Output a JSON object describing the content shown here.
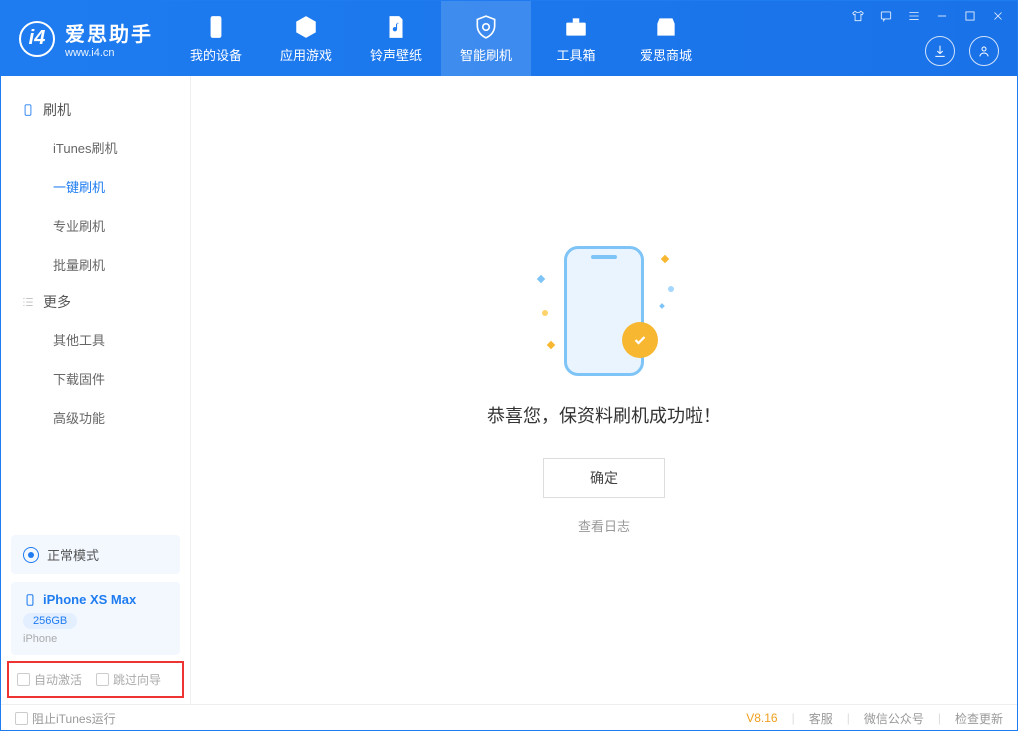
{
  "app": {
    "title": "爱思助手",
    "subtitle": "www.i4.cn"
  },
  "nav": {
    "tabs": [
      {
        "label": "我的设备"
      },
      {
        "label": "应用游戏"
      },
      {
        "label": "铃声壁纸"
      },
      {
        "label": "智能刷机"
      },
      {
        "label": "工具箱"
      },
      {
        "label": "爱思商城"
      }
    ]
  },
  "sidebar": {
    "group1_title": "刷机",
    "group1_items": [
      {
        "label": "iTunes刷机"
      },
      {
        "label": "一键刷机"
      },
      {
        "label": "专业刷机"
      },
      {
        "label": "批量刷机"
      }
    ],
    "group2_title": "更多",
    "group2_items": [
      {
        "label": "其他工具"
      },
      {
        "label": "下载固件"
      },
      {
        "label": "高级功能"
      }
    ],
    "mode_label": "正常模式",
    "device": {
      "name": "iPhone XS Max",
      "storage": "256GB",
      "type": "iPhone"
    },
    "options": {
      "auto_activate": "自动激活",
      "skip_guide": "跳过向导"
    }
  },
  "main": {
    "success_text": "恭喜您，保资料刷机成功啦！",
    "ok_button": "确定",
    "view_log": "查看日志"
  },
  "footer": {
    "prevent_itunes": "阻止iTunes运行",
    "version": "V8.16",
    "support": "客服",
    "wechat": "微信公众号",
    "check_update": "检查更新"
  }
}
